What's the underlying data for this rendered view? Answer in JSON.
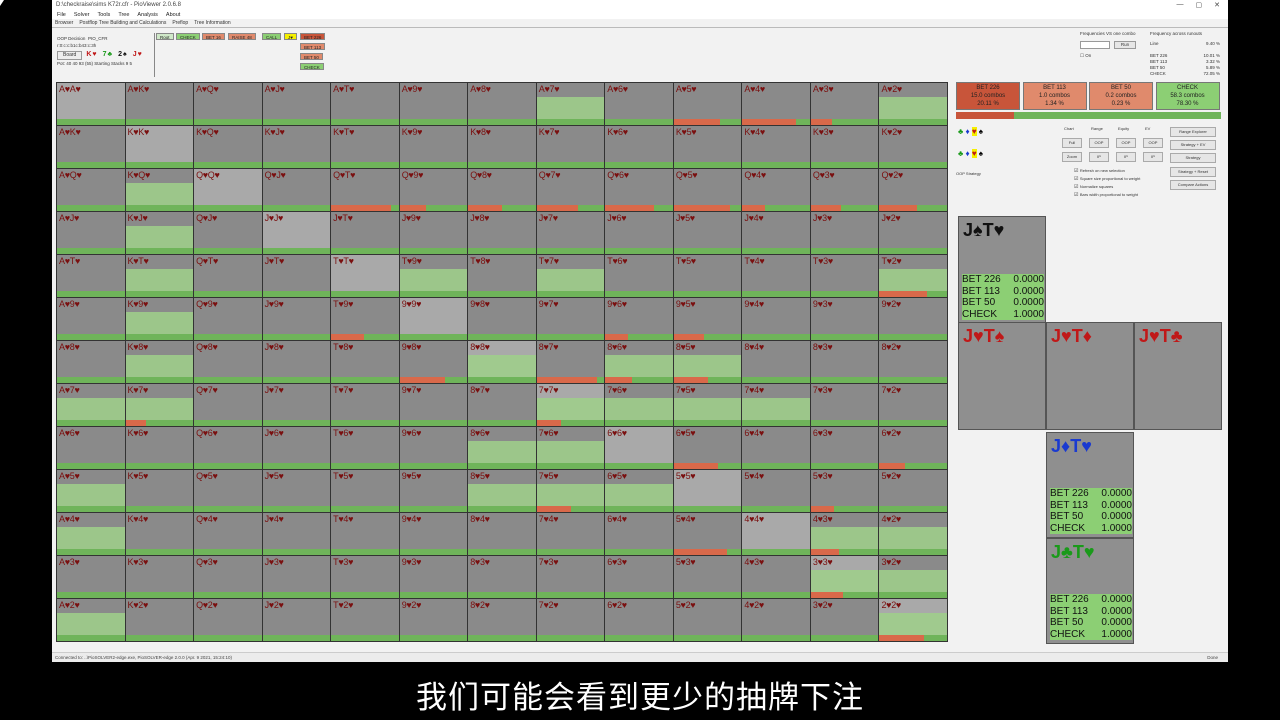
{
  "window": {
    "title": "D:\\checkraise\\sims K72r.cfr - PioViewer 2.0.6.8"
  },
  "menu": [
    "File",
    "Solver",
    "Tools",
    "Tree",
    "Analysis",
    "About"
  ],
  "tabs": [
    "Browser",
    "Postflop Tree Building and Calculations",
    "Preflop",
    "Tree Information"
  ],
  "info": {
    "decision": "OOP Decision",
    "player": "PIO_CFR",
    "path": "r:0:c:c:b1c:b43:c:3h",
    "board_button": "Board",
    "pot": "Pot: 40 40 93 (55) Starting Stacks 9 5"
  },
  "board_cards": [
    {
      "rank": "K",
      "suit": "♥",
      "color": "#c01818"
    },
    {
      "rank": "7",
      "suit": "♣",
      "color": "#1a9a1a"
    },
    {
      "rank": "2",
      "suit": "♠",
      "color": "#111111"
    },
    {
      "rank": "J",
      "suit": "♥",
      "color": "#c01818"
    }
  ],
  "tree_actions": [
    {
      "label": "Root",
      "bg": "#cfe8c8"
    },
    {
      "label": "CHECK",
      "bg": "#8ccf74"
    },
    {
      "label": "BET 16",
      "bg": "#e08a6c"
    },
    {
      "label": "RAISE 48",
      "bg": "#e08a6c"
    },
    {
      "label": "CALL",
      "bg": "#8ccf74"
    },
    {
      "label": "J♥",
      "bg": "#f5f000"
    },
    {
      "label": "BET 226",
      "bg": "#c8553a"
    },
    {
      "label": "BET 113",
      "bg": "#e08a6c"
    },
    {
      "label": "BET 50",
      "bg": "#e08a6c"
    },
    {
      "label": "CHECK",
      "bg": "#8ccf74"
    }
  ],
  "freq_panel": {
    "title_left": "Frequencies VS one combo",
    "title_right": "Frequency across runouts",
    "run_button": "Run",
    "on_label": "On",
    "line_label": "Line",
    "line_value": "9.40 %",
    "rows": [
      {
        "label": "BET 226",
        "value": "10.01 %"
      },
      {
        "label": "BET 113",
        "value": "3.32 %"
      },
      {
        "label": "BET 50",
        "value": "5.89 %"
      },
      {
        "label": "CHECK",
        "value": "72.05 %"
      }
    ]
  },
  "summary": [
    {
      "name": "BET 226",
      "combos": "15.0 combos",
      "pct": "20.11 %",
      "bg": "#c8553a"
    },
    {
      "name": "BET 113",
      "combos": "1.0 combos",
      "pct": "1.34 %",
      "bg": "#e08a6c"
    },
    {
      "name": "BET 50",
      "combos": "0.2 combos",
      "pct": "0.23 %",
      "bg": "#e08a6c"
    },
    {
      "name": "CHECK",
      "combos": "58.3 combos",
      "pct": "78.30 %",
      "bg": "#8ccf74"
    }
  ],
  "summary_bar_red_fraction": 0.22,
  "view_controls": {
    "headers": [
      "Chart",
      "Range",
      "Equity",
      "EV"
    ],
    "row1": [
      "Full",
      "OOP",
      "OOP",
      "OOP"
    ],
    "row2": [
      "Zoom",
      "IP",
      "IP",
      "IP"
    ],
    "right_buttons": [
      "Range Explorer",
      "Strategy + EV",
      "Strategy",
      "Strategy + Reset",
      "Compare Actions"
    ],
    "oop_strategy": "OOP Strategy",
    "options": [
      "Refresh on new selection",
      "Square size proportional to weight",
      "Normalize squares",
      "Bars width proportional to weight"
    ]
  },
  "selected_combos": [
    {
      "title": "J♠T♥",
      "lines": [
        [
          "BET 226",
          "0.0000"
        ],
        [
          "BET 113",
          "0.0000"
        ],
        [
          "BET 50",
          "0.0000"
        ],
        [
          "CHECK",
          "1.0000"
        ]
      ]
    },
    {
      "title": "J♥T♠"
    },
    {
      "title": "J♥T♦"
    },
    {
      "title": "J♥T♣"
    },
    {
      "title": "J♦T♥",
      "lines": [
        [
          "BET 226",
          "0.0000"
        ],
        [
          "BET 113",
          "0.0000"
        ],
        [
          "BET 50",
          "0.0000"
        ],
        [
          "CHECK",
          "1.0000"
        ]
      ]
    },
    {
      "title": "J♣T♥",
      "lines": [
        [
          "BET 226",
          "0.0000"
        ],
        [
          "BET 113",
          "0.0000"
        ],
        [
          "BET 50",
          "0.0000"
        ],
        [
          "CHECK",
          "1.0000"
        ]
      ]
    }
  ],
  "status": {
    "left": "Connected to: ..\\PioSOLVER2-edge.exe, PioSOLVER-edge 2.0.0 (Apr. 9 2021, 15:24:10)",
    "right": "Done"
  },
  "subtitle": "我们可能会看到更少的抽牌下注",
  "matrix_ranks": [
    "A",
    "K",
    "Q",
    "J",
    "T",
    "9",
    "8",
    "7",
    "6",
    "5",
    "4",
    "3",
    "2"
  ]
}
